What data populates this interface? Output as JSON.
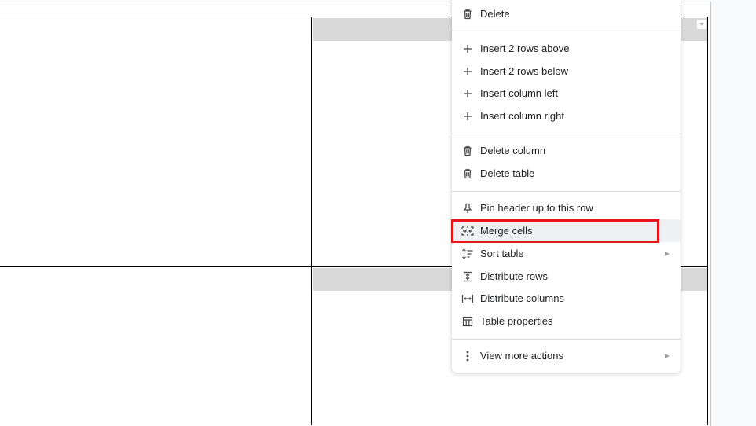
{
  "document": {
    "table": {
      "rows": 2,
      "columns": 2,
      "header_band_color": "#d9d9d9",
      "cell_dropdown_icon": "chevron-down-icon"
    }
  },
  "context_menu": {
    "items": [
      {
        "id": "delete",
        "label": "Delete",
        "icon": "trash-icon"
      },
      {
        "id": "insert-rows-above",
        "label": "Insert 2 rows above",
        "icon": "plus-icon"
      },
      {
        "id": "insert-rows-below",
        "label": "Insert 2 rows below",
        "icon": "plus-icon"
      },
      {
        "id": "insert-column-left",
        "label": "Insert column left",
        "icon": "plus-icon"
      },
      {
        "id": "insert-column-right",
        "label": "Insert column right",
        "icon": "plus-icon"
      },
      {
        "id": "delete-column",
        "label": "Delete column",
        "icon": "trash-icon"
      },
      {
        "id": "delete-table",
        "label": "Delete table",
        "icon": "trash-icon"
      },
      {
        "id": "pin-header",
        "label": "Pin header up to this row",
        "icon": "pin-icon"
      },
      {
        "id": "merge-cells",
        "label": "Merge cells",
        "icon": "merge-cells-icon",
        "hovered": true,
        "highlighted": true
      },
      {
        "id": "sort-table",
        "label": "Sort table",
        "icon": "sort-icon",
        "submenu": true
      },
      {
        "id": "distribute-rows",
        "label": "Distribute rows",
        "icon": "distribute-rows-icon"
      },
      {
        "id": "distribute-columns",
        "label": "Distribute columns",
        "icon": "distribute-columns-icon"
      },
      {
        "id": "table-properties",
        "label": "Table properties",
        "icon": "table-icon"
      },
      {
        "id": "view-more-actions",
        "label": "View more actions",
        "icon": "more-vert-icon",
        "submenu": true
      }
    ],
    "highlight_color": "#e8141c"
  }
}
